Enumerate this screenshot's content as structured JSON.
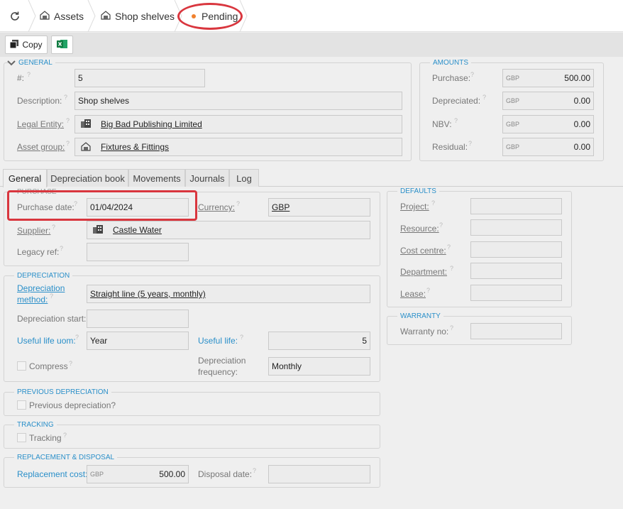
{
  "breadcrumb": {
    "refresh_icon": "refresh-icon",
    "items": [
      "Assets",
      "Shop shelves",
      "Pending"
    ],
    "status_color": "#f0812e"
  },
  "toolbar": {
    "copy_label": "Copy",
    "excel_icon": "excel-icon"
  },
  "general": {
    "legend": "GENERAL",
    "number_label": "#:",
    "number_value": "5",
    "description_label": "Description:",
    "description_value": "Shop shelves",
    "legal_entity_label": "Legal Entity:",
    "legal_entity_value": "Big Bad Publishing Limited",
    "asset_group_label": "Asset group:",
    "asset_group_value": "Fixtures & Fittings"
  },
  "amounts": {
    "legend": "AMOUNTS",
    "currency": "GBP",
    "rows": [
      {
        "label": "Purchase:",
        "value": "500.00"
      },
      {
        "label": "Depreciated:",
        "value": "0.00"
      },
      {
        "label": "NBV:",
        "value": "0.00"
      },
      {
        "label": "Residual:",
        "value": "0.00"
      }
    ]
  },
  "tabs": [
    "General",
    "Depreciation book",
    "Movements",
    "Journals",
    "Log"
  ],
  "purchase": {
    "legend": "PURCHASE",
    "date_label": "Purchase date:",
    "date_value": "01/04/2024",
    "currency_label": "Currency:",
    "currency_value": "GBP",
    "supplier_label": "Supplier:",
    "supplier_value": "Castle Water",
    "legacy_label": "Legacy ref:",
    "legacy_value": ""
  },
  "depreciation": {
    "legend": "DEPRECIATION",
    "method_label_1": "Depreciation",
    "method_label_2": "method:",
    "method_value": "Straight line (5 years, monthly)",
    "start_label": "Depreciation start:",
    "start_value": "",
    "uom_label": "Useful life uom:",
    "uom_value": "Year",
    "life_label": "Useful life:",
    "life_value": "5",
    "compress_label": "Compress",
    "freq_label_1": "Depreciation",
    "freq_label_2": "frequency:",
    "freq_value": "Monthly"
  },
  "previous": {
    "legend": "PREVIOUS DEPRECIATION",
    "label": "Previous depreciation?"
  },
  "tracking": {
    "legend": "TRACKING",
    "label": "Tracking"
  },
  "replacement": {
    "legend": "REPLACEMENT & DISPOSAL",
    "cost_label": "Replacement cost:",
    "cost_currency": "GBP",
    "cost_value": "500.00",
    "disposal_label": "Disposal date:",
    "disposal_value": ""
  },
  "defaults": {
    "legend": "DEFAULTS",
    "labels": [
      "Project:",
      "Resource:",
      "Cost centre:",
      "Department:",
      "Lease:"
    ]
  },
  "warranty": {
    "legend": "WARRANTY",
    "no_label": "Warranty no:",
    "no_value": ""
  },
  "annotation_color": "#d9363e"
}
